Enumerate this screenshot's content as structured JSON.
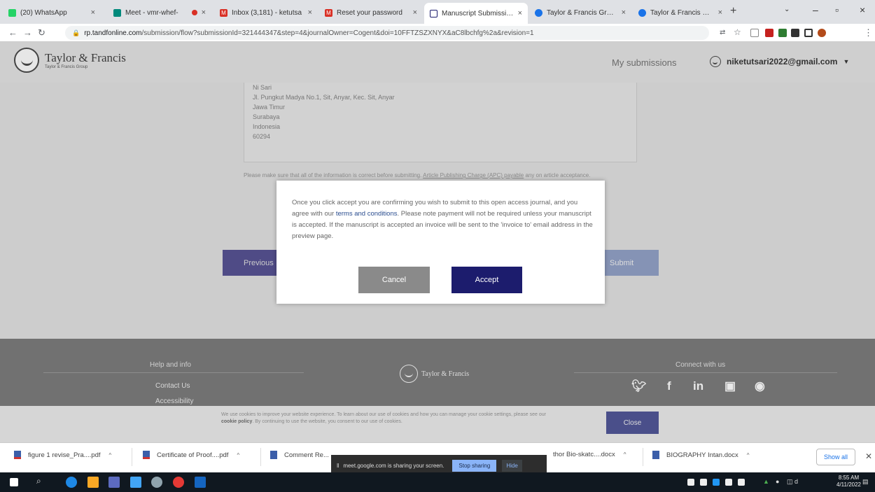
{
  "browser": {
    "tabs": [
      {
        "label": "(20) WhatsApp",
        "icon": "whatsapp-icon",
        "color": "#25d366"
      },
      {
        "label": "Meet - vmr-whef-",
        "icon": "meet-icon",
        "color": "#00897b"
      },
      {
        "label": "Inbox (3,181) - ketutsa",
        "icon": "gmail-icon",
        "color": "#d93025"
      },
      {
        "label": "Reset your password",
        "icon": "gmail-icon",
        "color": "#d93025"
      },
      {
        "label": "Manuscript Submission",
        "icon": "tf-icon",
        "color": "#1c1c6d",
        "active": true
      },
      {
        "label": "Taylor & Francis Group",
        "icon": "tf-icon",
        "color": "#1a73e8"
      },
      {
        "label": "Taylor & Francis Group",
        "icon": "tf-icon",
        "color": "#1a73e8"
      }
    ],
    "url_host": "rp.tandfonline.com",
    "url_rest": "/submission/flow?submissionId=321444347&step=4&journalOwner=Cogent&doi=10FFTZSZXNYX&aC8lbchfg%2a&revision=1"
  },
  "header": {
    "brand": "Taylor & Francis",
    "brand_sub": "Taylor & Francis Group",
    "my_submissions": "My submissions",
    "user_email": "niketutsari2022@gmail.com"
  },
  "address": {
    "lines": [
      "Ni Sari",
      "Jl. Pungkut Madya No.1, Sit, Anyar, Kec. Sit, Anyar",
      "Jawa Timur",
      "Surabaya",
      "Indonesia",
      "60294"
    ]
  },
  "note": {
    "pre": "Please make sure that all of the information is correct before submitting.",
    "link": "Article Publishing Charge (APC) payable",
    "post": "any on article acceptance."
  },
  "buttons": {
    "previous": "Previous",
    "submit": "Submit"
  },
  "modal": {
    "text_before": "Once you click accept you are confirming you wish to submit to this open access journal, and you agree with our ",
    "link": "terms and conditions",
    "text_after": ". Please note payment will not be required unless your manuscript is accepted. If the manuscript is accepted an invoice will be sent to the 'invoice to' email address in the preview page.",
    "cancel": "Cancel",
    "accept": "Accept"
  },
  "footer": {
    "help_title": "Help and info",
    "contact": "Contact Us",
    "accessibility": "Accessibility",
    "brand": "Taylor & Francis",
    "connect_title": "Connect with us"
  },
  "cookie": {
    "text": "We use cookies to improve your website experience. To learn about our use of cookies and how you can manage your cookie settings, please see our",
    "policy": "cookie policy",
    "text2": ". By continuing to use the website, you consent to our use of cookies.",
    "close": "Close"
  },
  "downloads": {
    "items": [
      "figure 1 revise_Pra....pdf",
      "Certificate of Proof....pdf",
      "Comment Re...",
      "thor Bio-skatc....docx",
      "BIOGRAPHY Intan.docx"
    ],
    "show_all": "Show all"
  },
  "screen_share": {
    "text": "meet.google.com is sharing your screen.",
    "stop": "Stop sharing",
    "hide": "Hide"
  },
  "taskbar": {
    "time": "8:55 AM",
    "date": "4/11/2022"
  }
}
